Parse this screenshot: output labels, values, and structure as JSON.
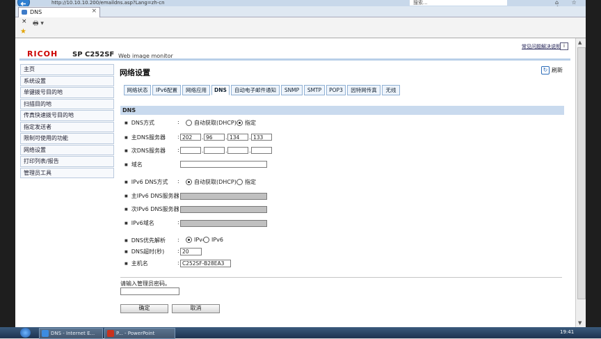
{
  "browser": {
    "url": "http://10.10.10.200/emaildns.asp?Lang=zh-cn",
    "search_placeholder": "搜索...",
    "tab_title": "DNS",
    "window_buttons": "⌂ ☆ ⚙",
    "cmd_close": "×",
    "cmd_tools": "🖶 ▾",
    "fav_star": "★"
  },
  "header": {
    "logo": "RICOH",
    "model": "SP C252SF",
    "subtitle": "Web image monitor",
    "help_link": "常见问题解决说明",
    "help_icon": "i"
  },
  "sidebar": {
    "items": [
      {
        "label": "主页"
      },
      {
        "label": "系统设置"
      },
      {
        "label": "单键拨号目的地"
      },
      {
        "label": "扫描目的地"
      },
      {
        "label": "传真快速拨号目的地"
      },
      {
        "label": "指定发送者"
      },
      {
        "label": "限制可使用的功能"
      },
      {
        "label": "网络设置"
      },
      {
        "label": "打印列表/报告"
      },
      {
        "label": "管理员工具"
      }
    ]
  },
  "main": {
    "title": "网络设置",
    "refresh_label": "刷新",
    "refresh_icon": "↻",
    "tabs": [
      {
        "label": "网络状态"
      },
      {
        "label": "IPv6配置"
      },
      {
        "label": "网络应用"
      },
      {
        "label": "DNS"
      },
      {
        "label": "自动电子邮件通知"
      },
      {
        "label": "SNMP"
      },
      {
        "label": "SMTP"
      },
      {
        "label": "POP3"
      },
      {
        "label": "因特网传真"
      },
      {
        "label": "无线"
      }
    ],
    "section_title": "DNS",
    "colon": ":",
    "ip_dot": ".",
    "fields": {
      "dns_method": {
        "label": "DNS方式",
        "option1": "自动获取(DHCP)",
        "option2": "指定"
      },
      "primary_dns": {
        "label": "主DNS服务器",
        "octets": [
          "202",
          "96",
          "134",
          "133"
        ]
      },
      "secondary_dns": {
        "label": "次DNS服务器",
        "octets": [
          "",
          "",
          "",
          ""
        ]
      },
      "domain": {
        "label": "域名",
        "value": ""
      },
      "ipv6_dns_method": {
        "label": "IPv6 DNS方式",
        "option1": "自动获取(DHCP)",
        "option2": "指定"
      },
      "ipv6_primary_dns": {
        "label": "主IPv6 DNS服务器",
        "value": ""
      },
      "ipv6_secondary_dns": {
        "label": "次IPv6 DNS服务器",
        "value": ""
      },
      "ipv6_domain": {
        "label": "IPv6域名",
        "value": ""
      },
      "dns_priority": {
        "label": "DNS优先解析",
        "option1": "IPv4",
        "option2": "IPv6"
      },
      "dns_timeout": {
        "label": "DNS超时(秒)",
        "value": "20"
      },
      "hostname": {
        "label": "主机名",
        "value": "C252SF-B28EA3"
      }
    },
    "password_label": "请输入管理员密码。",
    "ok_label": "确定",
    "cancel_label": "取消"
  },
  "taskbar": {
    "task1": "DNS - Internet E...",
    "task2": "P... - PowerPoint",
    "clock": "19:41"
  }
}
